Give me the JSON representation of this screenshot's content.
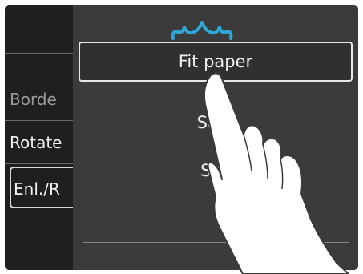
{
  "left_menu": {
    "items": [
      {
        "label": "Borde"
      },
      {
        "label": "Rotate"
      },
      {
        "label": "Enl./R"
      }
    ]
  },
  "overlay_menu": {
    "options": [
      {
        "label": "Fit paper"
      },
      {
        "label": "Sam"
      },
      {
        "label": "Sca"
      }
    ]
  },
  "colors": {
    "accent": "#2ca7d8",
    "screen_bg": "#1b1c1c",
    "overlay_bg": "#3a3b3a"
  }
}
